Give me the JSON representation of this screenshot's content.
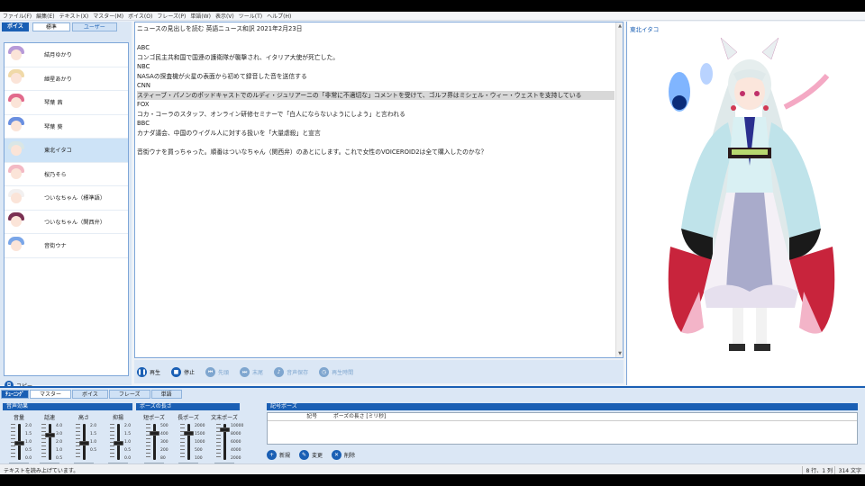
{
  "menu": [
    "ファイル(F)",
    "編集(E)",
    "テキスト(X)",
    "マスター(M)",
    "ボイス(O)",
    "フレーズ(P)",
    "単語(W)",
    "表示(V)",
    "ツール(T)",
    "ヘルプ(H)"
  ],
  "voice_panel": {
    "tab_voice": "ボイス",
    "tab_standard": "標準",
    "tab_user": "ユーザー",
    "items": [
      {
        "name": "結月ゆかり",
        "hair": "#b79ad8"
      },
      {
        "name": "紲星あかり",
        "hair": "#f0d9a8"
      },
      {
        "name": "琴葉 茜",
        "hair": "#e26a8c"
      },
      {
        "name": "琴葉 葵",
        "hair": "#6a8fe0"
      },
      {
        "name": "東北イタコ",
        "hair": "#d9e6e6"
      },
      {
        "name": "桜乃そら",
        "hair": "#f3b9c4"
      },
      {
        "name": "ついなちゃん（標準語）",
        "hair": "#f2f0f0"
      },
      {
        "name": "ついなちゃん（関西弁）",
        "hair": "#7a3052"
      },
      {
        "name": "音街ウナ",
        "hair": "#7aa6e8"
      }
    ],
    "selected_index": 4,
    "copy_label": "コピー"
  },
  "editor": {
    "lines": [
      "ニュースの見出しを読む 英語ニュース和訳 2021年2月23日",
      "",
      "ABC",
      "コンゴ民主共和国で国連の護衛隊が襲撃され、イタリア大使が死亡した。",
      "NBC",
      "NASAの探査機が火星の表面から初めて録音した音を送信する",
      "CNN",
      "スティーブ・パノンのポッドキャストでのルディ・ジュリアーニの「非常に不適切な」コメントを受けて、ゴルフ界はミシェル・ウィー・ウェストを支持している",
      "FOX",
      "コカ・コーラのスタッフ、オンライン研修セミナーで「白人にならないようにしよう」と言われる",
      "BBC",
      "カナダ議会、中国のウイグル人に対する扱いを「大量虐殺」と宣言",
      "",
      "音街ウナを買っちゃった。順番はついなちゃん（関西弁）のあとにします。これで女性のVOICEROID2は全て購入したのかな？"
    ],
    "highlight_line": 7
  },
  "playback": {
    "play": "再生",
    "stop": "停止",
    "prev": "先頭",
    "next": "末尾",
    "save": "音声保存",
    "time": "再生時間"
  },
  "character": {
    "name": "東北イタコ"
  },
  "tuning": {
    "tab_tuning": "ﾁｭｰﾆﾝｸﾞ",
    "tabs": [
      "マスター",
      "ボイス",
      "フレーズ",
      "単語"
    ],
    "active_tab": 0,
    "group_voice_effect": "音声効果",
    "group_pause_length": "ポーズの長さ",
    "group_symbol_pause": "記号ポーズ",
    "sliders": [
      {
        "label": "音量",
        "ticks": [
          "2.0",
          "1.5",
          "1.0",
          "0.5",
          "0.0"
        ],
        "value_fraction": 0.5
      },
      {
        "label": "話速",
        "ticks": [
          "4.0",
          "3.0",
          "2.0",
          "1.0",
          "0.5"
        ],
        "value_fraction": 0.75
      },
      {
        "label": "高さ",
        "ticks": [
          "2.0",
          "1.5",
          "1.0",
          "0.5"
        ],
        "value_fraction": 0.5
      },
      {
        "label": "抑揚",
        "ticks": [
          "2.0",
          "1.5",
          "1.0",
          "0.5",
          "0.0"
        ],
        "value_fraction": 0.5
      },
      {
        "label": "短ポーズ",
        "ticks": [
          "500",
          "400",
          "300",
          "200",
          "80"
        ],
        "value_fraction": 0.8
      },
      {
        "label": "長ポーズ",
        "ticks": [
          "2000",
          "1500",
          "1000",
          "500",
          "100"
        ],
        "value_fraction": 0.8
      },
      {
        "label": "文末ポーズ",
        "ticks": [
          "10000",
          "8000",
          "6000",
          "4000",
          "2000",
          "0"
        ],
        "value_fraction": 0.9
      }
    ],
    "symbol_columns": [
      "記号",
      "ポーズの長さ [ミリ秒]"
    ],
    "symbol_new": "新規",
    "symbol_edit": "変更",
    "symbol_delete": "削除"
  },
  "status": {
    "message": "テキストを読み上げています。",
    "position": "8 行、1 列",
    "count": "314 文字"
  },
  "colors": {
    "accent": "#1a5fb4",
    "panel": "#dbe7f5"
  }
}
